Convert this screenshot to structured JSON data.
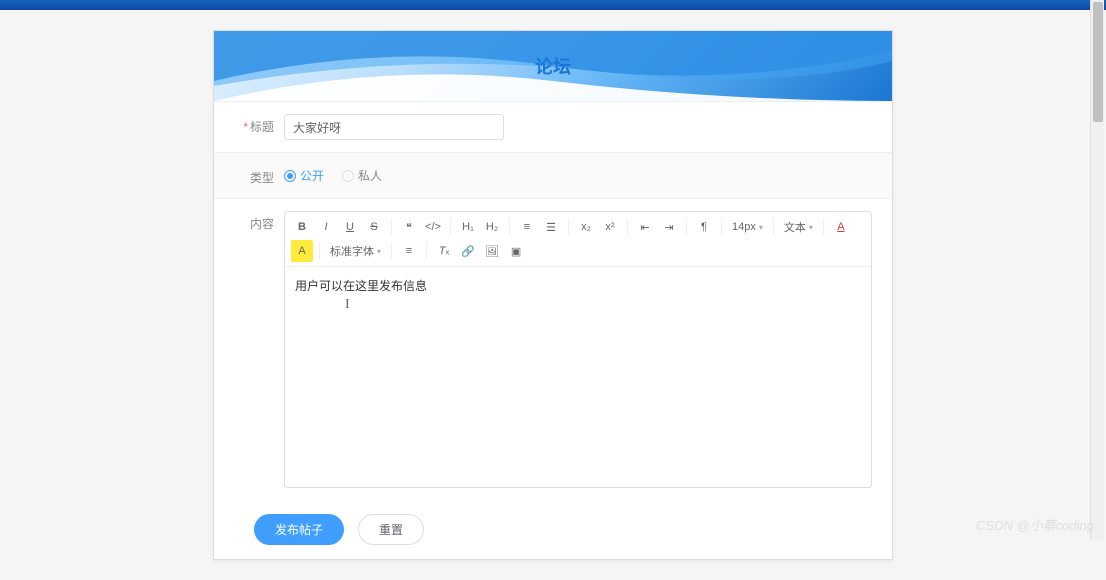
{
  "banner": {
    "title": "论坛"
  },
  "form": {
    "title_label": "标题",
    "title_value": "大家好呀",
    "type_label": "类型",
    "type_options": {
      "public": "公开",
      "private": "私人"
    },
    "type_selected": "public",
    "content_label": "内容",
    "content_value": "用户可以在这里发布信息"
  },
  "toolbar": {
    "font_size": "14px",
    "format": "文本",
    "font_family": "标准字体"
  },
  "buttons": {
    "submit": "发布帖子",
    "reset": "重置"
  },
  "watermark": "CSDN @小蔡coding"
}
